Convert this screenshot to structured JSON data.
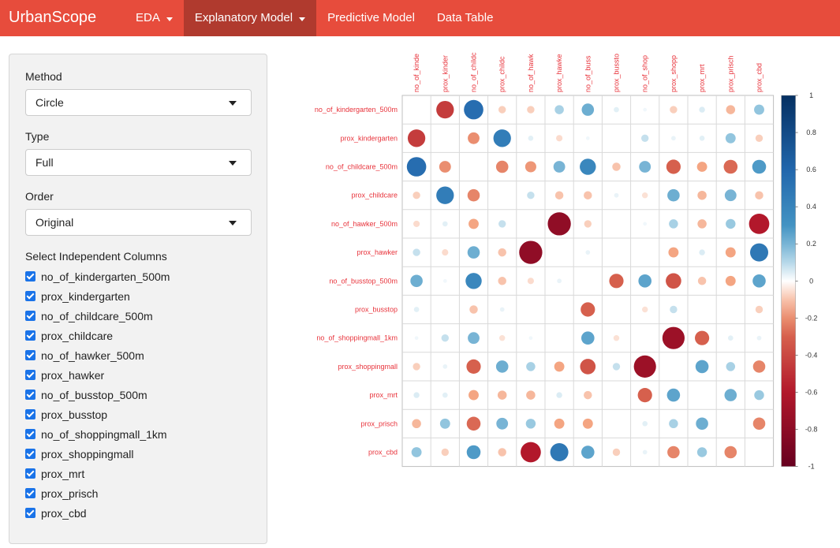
{
  "navbar": {
    "brand": "UrbanScope",
    "items": [
      {
        "label": "EDA",
        "dropdown": true,
        "active": false
      },
      {
        "label": "Explanatory Model",
        "dropdown": true,
        "active": true
      },
      {
        "label": "Predictive Model",
        "dropdown": false,
        "active": false
      },
      {
        "label": "Data Table",
        "dropdown": false,
        "active": false
      }
    ],
    "color": "#e74c3c",
    "active_color": "#b03a2e"
  },
  "sidebar": {
    "method": {
      "label": "Method",
      "value": "Circle"
    },
    "type": {
      "label": "Type",
      "value": "Full"
    },
    "order": {
      "label": "Order",
      "value": "Original"
    },
    "columns_title": "Select Independent Columns",
    "columns": [
      {
        "label": "no_of_kindergarten_500m",
        "checked": true
      },
      {
        "label": "prox_kindergarten",
        "checked": true
      },
      {
        "label": "no_of_childcare_500m",
        "checked": true
      },
      {
        "label": "prox_childcare",
        "checked": true
      },
      {
        "label": "no_of_hawker_500m",
        "checked": true
      },
      {
        "label": "prox_hawker",
        "checked": true
      },
      {
        "label": "no_of_busstop_500m",
        "checked": true
      },
      {
        "label": "prox_busstop",
        "checked": true
      },
      {
        "label": "no_of_shoppingmall_1km",
        "checked": true
      },
      {
        "label": "prox_shoppingmall",
        "checked": true
      },
      {
        "label": "prox_mrt",
        "checked": true
      },
      {
        "label": "prox_prisch",
        "checked": true
      },
      {
        "label": "prox_cbd",
        "checked": true
      }
    ]
  },
  "chart_data": {
    "type": "heatmap",
    "subtype": "correlation-circle",
    "row_labels": [
      "no_of_kindergarten_500m",
      "prox_kindergarten",
      "no_of_childcare_500m",
      "prox_childcare",
      "no_of_hawker_500m",
      "prox_hawker",
      "no_of_busstop_500m",
      "prox_busstop",
      "no_of_shoppingmall_1km",
      "prox_shoppingmall",
      "prox_mrt",
      "prox_prisch",
      "prox_cbd"
    ],
    "col_labels": [
      "no_of_kinde",
      "prox_kinder",
      "no_of_childc",
      "prox_childc",
      "no_of_hawk",
      "prox_hawke",
      "no_of_buss",
      "prox_bussto",
      "no_of_shop",
      "prox_shopp",
      "prox_mrt",
      "prox_prisch",
      "prox_cbd"
    ],
    "matrix": [
      [
        0,
        -0.45,
        0.55,
        -0.08,
        -0.08,
        0.12,
        0.22,
        0.04,
        0.02,
        -0.08,
        0.05,
        -0.12,
        0.15
      ],
      [
        -0.45,
        0,
        -0.2,
        0.45,
        0.04,
        -0.06,
        0.02,
        0.0,
        0.08,
        0.03,
        0.04,
        0.15,
        -0.08
      ],
      [
        0.55,
        -0.2,
        0,
        -0.22,
        -0.18,
        0.2,
        0.38,
        -0.1,
        0.2,
        -0.3,
        -0.15,
        -0.28,
        0.28
      ],
      [
        -0.08,
        0.45,
        -0.22,
        0,
        0.08,
        -0.1,
        -0.1,
        0.03,
        -0.05,
        0.22,
        -0.12,
        0.2,
        -0.1
      ],
      [
        -0.06,
        0.04,
        -0.15,
        0.08,
        0,
        -0.78,
        -0.08,
        0.0,
        0.02,
        0.12,
        -0.12,
        0.14,
        -0.6
      ],
      [
        0.08,
        -0.06,
        0.22,
        -0.1,
        -0.78,
        0,
        0.03,
        0.0,
        0.0,
        -0.15,
        0.05,
        -0.15,
        0.48
      ],
      [
        0.22,
        0.02,
        0.38,
        -0.1,
        -0.06,
        0.03,
        0,
        -0.3,
        0.25,
        -0.35,
        -0.1,
        -0.15,
        0.25
      ],
      [
        0.04,
        0.0,
        -0.1,
        0.03,
        0.0,
        0.0,
        -0.3,
        0,
        -0.05,
        0.08,
        0.0,
        0.0,
        -0.08
      ],
      [
        0.02,
        0.08,
        0.2,
        -0.05,
        0.02,
        0.0,
        0.25,
        -0.05,
        0,
        -0.72,
        -0.3,
        0.04,
        0.03
      ],
      [
        -0.08,
        0.03,
        -0.3,
        0.22,
        0.12,
        -0.15,
        -0.35,
        0.08,
        -0.72,
        0,
        0.25,
        0.12,
        -0.22
      ],
      [
        0.05,
        0.04,
        -0.15,
        -0.12,
        -0.12,
        0.05,
        -0.1,
        0.0,
        -0.3,
        0.25,
        0,
        0.22,
        0.14
      ],
      [
        -0.12,
        0.15,
        -0.28,
        0.2,
        0.14,
        -0.15,
        -0.15,
        0.0,
        0.04,
        0.12,
        0.22,
        0,
        -0.22
      ],
      [
        0.15,
        -0.08,
        0.28,
        -0.1,
        -0.6,
        0.48,
        0.25,
        -0.08,
        0.03,
        -0.22,
        0.14,
        -0.22,
        0
      ]
    ],
    "colorbar": {
      "range": [
        -1,
        1
      ],
      "ticks": [
        "1",
        "0.8",
        "0.6",
        "0.4",
        "0.2",
        "0",
        "-0.2",
        "-0.4",
        "-0.6",
        "-0.8",
        "-1"
      ]
    },
    "label_color": "#e8333b",
    "positive_color": "#2166ac",
    "negative_color": "#b2182b"
  }
}
